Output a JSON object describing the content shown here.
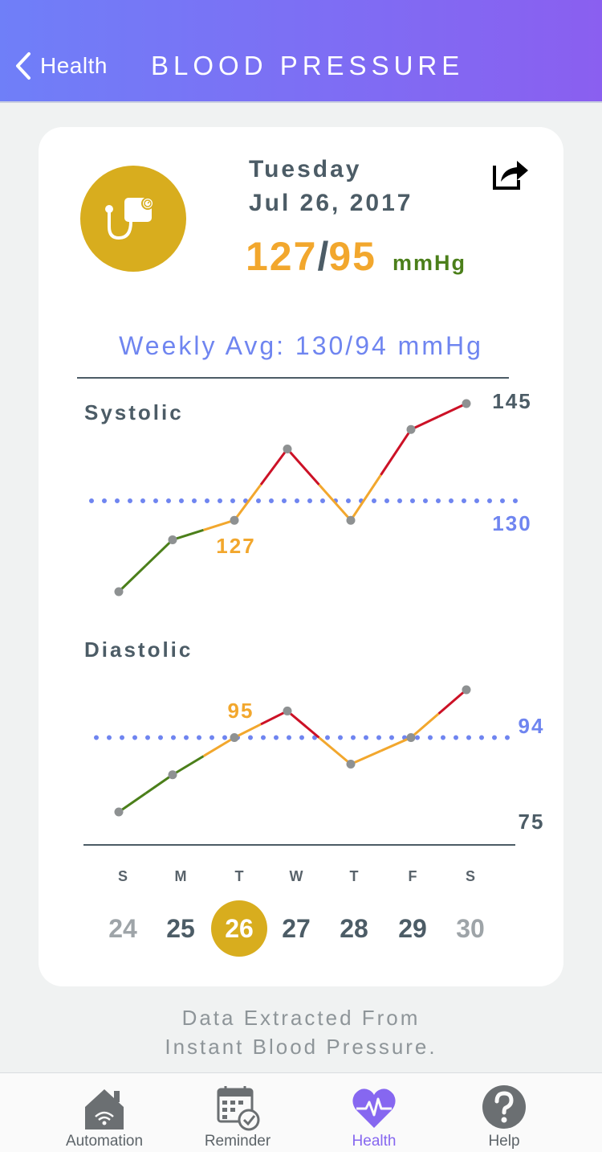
{
  "header": {
    "back_label": "Health",
    "title": "BLOOD PRESSURE"
  },
  "reading": {
    "day": "Tuesday",
    "date": "Jul 26, 2017",
    "systolic": "127",
    "separator": "/",
    "diastolic": "95",
    "unit": "mmHg"
  },
  "weekly_avg": "Weekly Avg: 130/94 mmHg",
  "chart_data": [
    {
      "type": "line",
      "title": "Systolic",
      "x": [
        "24",
        "25",
        "26",
        "27",
        "28",
        "29",
        "30"
      ],
      "values": [
        116,
        124,
        127,
        138,
        127,
        141,
        145
      ],
      "average": 130,
      "label_max": "145",
      "label_avg": "130",
      "highlight_label": "127",
      "colors": {
        "low": "#4b7f1a",
        "normal": "#f2a72d",
        "high": "#cc1126",
        "average": "#6f85f0"
      }
    },
    {
      "type": "line",
      "title": "Diastolic",
      "x": [
        "24",
        "25",
        "26",
        "27",
        "28",
        "29",
        "30"
      ],
      "values": [
        80,
        87,
        94,
        99,
        89,
        94,
        103
      ],
      "average": 94,
      "label_avg": "94",
      "label_min": "75",
      "highlight_label": "95",
      "colors": {
        "low": "#4b7f1a",
        "normal": "#f2a72d",
        "high": "#cc1126",
        "average": "#6f85f0"
      }
    }
  ],
  "week": {
    "days_of_week": [
      "S",
      "M",
      "T",
      "W",
      "T",
      "F",
      "S"
    ],
    "dates": [
      "24",
      "25",
      "26",
      "27",
      "28",
      "29",
      "30"
    ],
    "selected": "26"
  },
  "footer_note": {
    "line1": "Data Extracted From",
    "line2": "Instant Blood Pressure."
  },
  "tabs": [
    {
      "label": "Automation",
      "icon": "home-icon"
    },
    {
      "label": "Reminder",
      "icon": "calendar-check-icon"
    },
    {
      "label": "Health",
      "icon": "heart-pulse-icon"
    },
    {
      "label": "Help",
      "icon": "help-icon"
    }
  ],
  "colors": {
    "header_start": "#6f7ff8",
    "header_end": "#8a5ff0",
    "accent_gold": "#d8ad1e",
    "reading_orange": "#f2a72d",
    "unit_green": "#4b7f1a",
    "avg_blue": "#6f85f0",
    "tab_active": "#8667f0"
  }
}
